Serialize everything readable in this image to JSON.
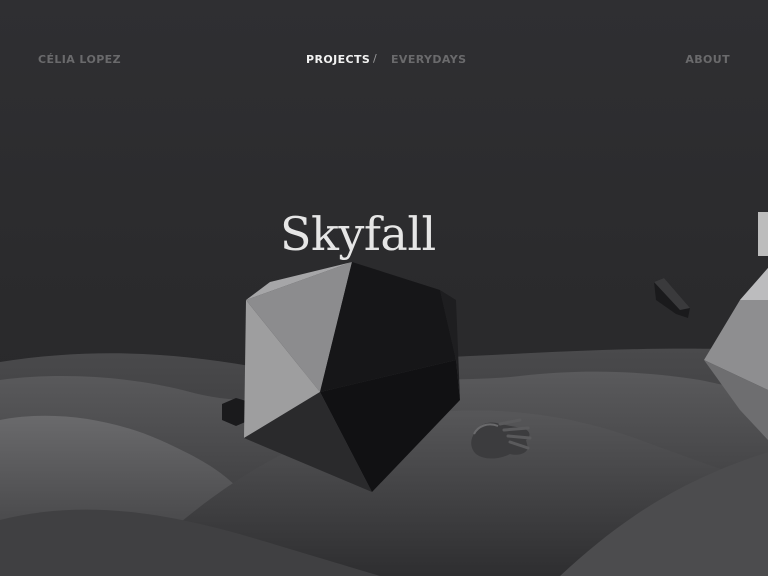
{
  "nav": {
    "brand": "CÉLIA LOPEZ",
    "projects": "PROJECTS",
    "separator": "/",
    "everydays": "EVERYDAYS",
    "about": "ABOUT"
  },
  "project": {
    "title": "Skyfall"
  },
  "colors": {
    "background": "#2b2b2d",
    "nav_active": "#f2f2f2",
    "nav_inactive": "#6a6a6c",
    "title": "#e6e6e6"
  }
}
